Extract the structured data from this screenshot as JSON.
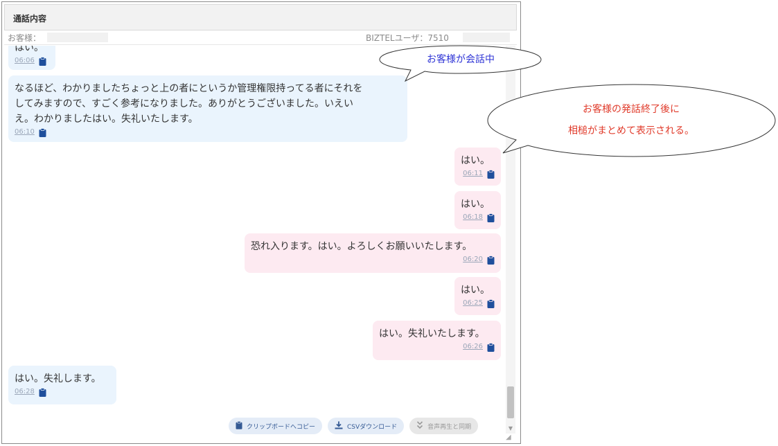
{
  "header": {
    "title": "通話内容"
  },
  "subheader": {
    "customer_label": "お客様：",
    "user_label": "BIZTELユーザ：7510"
  },
  "messages": [
    {
      "speaker": "customer",
      "text": "はい。",
      "time": "06:06"
    },
    {
      "speaker": "customer",
      "lines": [
        "なるほど、わかりましたちょっと上の者にというか管理権限持ってる者にそれを",
        "してみますので、すごく参考になりました。ありがとうございました。いえい",
        "え。わかりましたはい。失礼いたします。"
      ],
      "time": "06:10"
    },
    {
      "speaker": "user",
      "text": "はい。",
      "time": "06:11"
    },
    {
      "speaker": "user",
      "text": "はい。",
      "time": "06:18"
    },
    {
      "speaker": "user",
      "text": "恐れ入ります。はい。よろしくお願いいたします。",
      "time": "06:20"
    },
    {
      "speaker": "user",
      "text": "はい。",
      "time": "06:25"
    },
    {
      "speaker": "user",
      "text": "はい。失礼いたします。",
      "time": "06:26"
    },
    {
      "speaker": "customer",
      "text": "はい。失礼します。",
      "time": "06:28"
    }
  ],
  "toolbar": {
    "copy_label": "クリップボードへコピー",
    "csv_label": "CSVダウンロード",
    "sync_label": "音声再生と同期"
  },
  "callouts": {
    "customer_talking": "お客様が会話中",
    "note_line1": "お客様の発話終了後に",
    "note_line2": "相槌がまとめて表示される。"
  },
  "colors": {
    "customer_bubble": "#eaf4fd",
    "user_bubble": "#fdeaf1",
    "callout_blue_text": "#2f35d6",
    "callout_red_text": "#e03a2a",
    "button_text": "#355a94"
  },
  "icons": {
    "clipboard": "clipboard-icon",
    "download": "download-icon",
    "sync": "sync-icon"
  }
}
